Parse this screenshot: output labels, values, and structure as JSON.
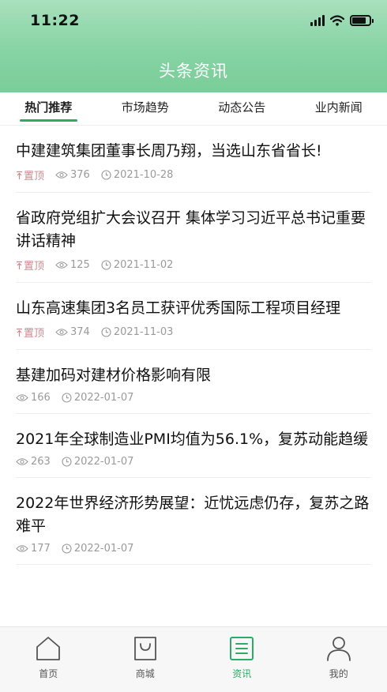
{
  "status_bar": {
    "time": "11:22"
  },
  "header": {
    "title": "头条资讯"
  },
  "tabs": [
    {
      "label": "热门推荐",
      "active": true
    },
    {
      "label": "市场趋势",
      "active": false
    },
    {
      "label": "动态公告",
      "active": false
    },
    {
      "label": "业内新闻",
      "active": false
    }
  ],
  "news": [
    {
      "title": "中建建筑集团董事长周乃翔，当选山东省省长!",
      "pinned": true,
      "pin_label": "置顶",
      "views": "376",
      "date": "2021-10-28"
    },
    {
      "title": "省政府党组扩大会议召开 集体学习习近平总书记重要讲话精神",
      "pinned": true,
      "pin_label": "置顶",
      "views": "125",
      "date": "2021-11-02"
    },
    {
      "title": "山东高速集团3名员工获评优秀国际工程项目经理",
      "pinned": true,
      "pin_label": "置顶",
      "views": "374",
      "date": "2021-11-03"
    },
    {
      "title": "基建加码对建材价格影响有限",
      "pinned": false,
      "views": "166",
      "date": "2022-01-07"
    },
    {
      "title": "2021年全球制造业PMI均值为56.1%，复苏动能趋缓",
      "pinned": false,
      "views": "263",
      "date": "2022-01-07"
    },
    {
      "title": "2022年世界经济形势展望：近忧远虑仍存，复苏之路难平",
      "pinned": false,
      "views": "177",
      "date": "2022-01-07"
    }
  ],
  "tabbar": [
    {
      "label": "首页",
      "icon": "home-icon",
      "active": false
    },
    {
      "label": "商城",
      "icon": "shopping-bag-icon",
      "active": false
    },
    {
      "label": "资讯",
      "icon": "news-icon",
      "active": true
    },
    {
      "label": "我的",
      "icon": "person-icon",
      "active": false
    }
  ],
  "colors": {
    "header_green": "#86d3a3",
    "accent_green": "#2eaa66",
    "pin_tag": "#c98a8f",
    "meta_gray": "#9a9a9a"
  }
}
